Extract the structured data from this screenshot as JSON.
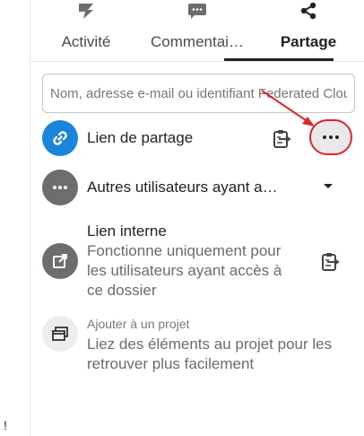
{
  "tabs": [
    {
      "label": "Activité",
      "icon": "activity-bolt-icon"
    },
    {
      "label": "Commentai…",
      "icon": "comment-icon"
    },
    {
      "label": "Partage",
      "icon": "share-icon"
    }
  ],
  "search": {
    "placeholder": "Nom, adresse e-mail ou identifiant Federated Cloud"
  },
  "share_link": {
    "title": "Lien de partage"
  },
  "others": {
    "title": "Autres utilisateurs ayant a…"
  },
  "internal": {
    "title": "Lien interne",
    "subtitle": "Fonctionne uniquement pour les utilisateurs ayant accès à ce dossier"
  },
  "project": {
    "title": "Ajouter à un projet",
    "subtitle": "Liez des éléments au projet pour les retrouver plus facilement"
  },
  "left_mark": "!",
  "colors": {
    "accent": "#1b86d9",
    "highlight": "#e2232b",
    "grey": "#6d6d6d"
  }
}
